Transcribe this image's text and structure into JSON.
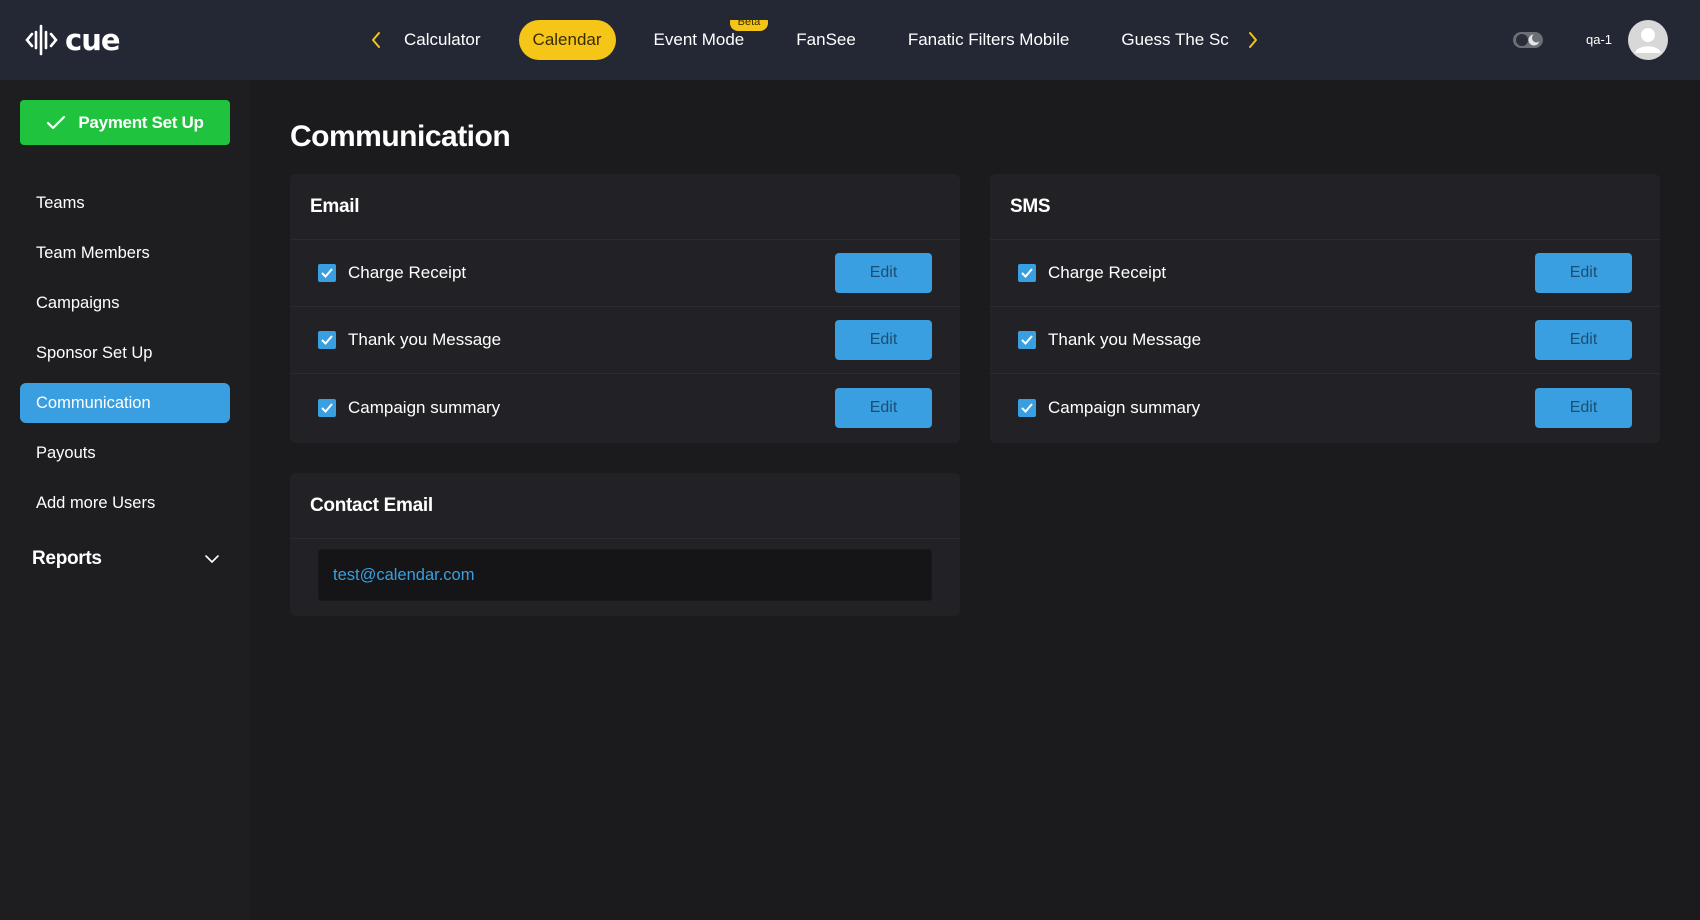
{
  "app": {
    "logo_text": "cue",
    "username": "qa-1"
  },
  "top_tabs": [
    {
      "label": "Calculator",
      "active": false
    },
    {
      "label": "Calendar",
      "active": true
    },
    {
      "label": "Event Mode",
      "active": false,
      "badge": "Beta"
    },
    {
      "label": "FanSee",
      "active": false
    },
    {
      "label": "Fanatic Filters Mobile",
      "active": false
    },
    {
      "label": "Guess The Sc",
      "active": false
    }
  ],
  "sidebar": {
    "payment_button": "Payment Set Up",
    "items": [
      {
        "label": "Teams",
        "active": false
      },
      {
        "label": "Team Members",
        "active": false
      },
      {
        "label": "Campaigns",
        "active": false
      },
      {
        "label": "Sponsor Set Up",
        "active": false
      },
      {
        "label": "Communication",
        "active": true
      },
      {
        "label": "Payouts",
        "active": false
      },
      {
        "label": "Add more Users",
        "active": false
      }
    ],
    "reports_label": "Reports"
  },
  "main": {
    "title": "Communication",
    "email_card": {
      "title": "Email",
      "rows": [
        {
          "label": "Charge Receipt",
          "checked": true,
          "button": "Edit"
        },
        {
          "label": "Thank you Message",
          "checked": true,
          "button": "Edit"
        },
        {
          "label": "Campaign summary",
          "checked": true,
          "button": "Edit"
        }
      ]
    },
    "sms_card": {
      "title": "SMS",
      "rows": [
        {
          "label": "Charge Receipt",
          "checked": true,
          "button": "Edit"
        },
        {
          "label": "Thank you Message",
          "checked": true,
          "button": "Edit"
        },
        {
          "label": "Campaign summary",
          "checked": true,
          "button": "Edit"
        }
      ]
    },
    "contact_card": {
      "title": "Contact Email",
      "email_value": "test@calendar.com"
    }
  },
  "colors": {
    "accent_blue": "#3a9fe0",
    "accent_yellow": "#f5c518",
    "success_green": "#1fc33d",
    "topbar_bg": "#232834",
    "page_bg": "#1b1b1e"
  }
}
